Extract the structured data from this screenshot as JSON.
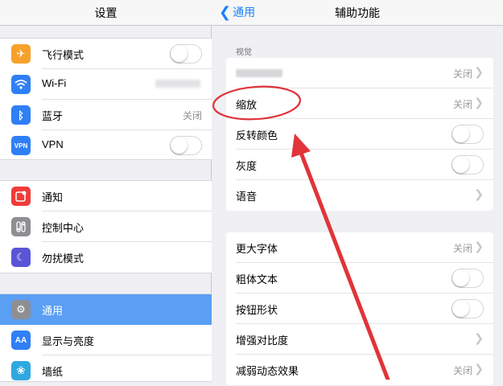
{
  "left": {
    "title": "设置",
    "group1": [
      {
        "label": "飞行模式",
        "icon": "airplane-icon",
        "icon_color": "#f7a12b",
        "control": "switch",
        "value": ""
      },
      {
        "label": "Wi-Fi",
        "icon": "wifi-icon",
        "icon_color": "#2f7ff6",
        "control": "value",
        "value": ""
      },
      {
        "label": "蓝牙",
        "icon": "bluetooth-icon",
        "icon_color": "#2f7ff6",
        "control": "value",
        "value": "关闭"
      },
      {
        "label": "VPN",
        "icon": "vpn-icon",
        "icon_color": "#2f7ff6",
        "control": "switch",
        "value": ""
      }
    ],
    "group2": [
      {
        "label": "通知",
        "icon": "notification-icon",
        "icon_color": "#f03b39"
      },
      {
        "label": "控制中心",
        "icon": "control-center-icon",
        "icon_color": "#8e8e93"
      },
      {
        "label": "勿扰模式",
        "icon": "moon-icon",
        "icon_color": "#5a55d6"
      }
    ],
    "group3": [
      {
        "label": "通用",
        "icon": "gear-icon",
        "icon_color": "#8e8e93",
        "selected": true
      },
      {
        "label": "显示与亮度",
        "icon": "display-icon",
        "icon_color": "#2f7ff6"
      },
      {
        "label": "墙纸",
        "icon": "wallpaper-icon",
        "icon_color": "#2fa8e0"
      }
    ]
  },
  "right": {
    "back_label": "通用",
    "title": "辅助功能",
    "section_label": "视觉",
    "card1": [
      {
        "label": "",
        "blurred": true,
        "value": "关闭",
        "chevron": true
      },
      {
        "label": "缩放",
        "value": "关闭",
        "chevron": true,
        "highlighted": true
      },
      {
        "label": "反转颜色",
        "control": "switch"
      },
      {
        "label": "灰度",
        "control": "switch"
      },
      {
        "label": "语音",
        "chevron": true
      }
    ],
    "card2": [
      {
        "label": "更大字体",
        "value": "关闭",
        "chevron": true
      },
      {
        "label": "粗体文本",
        "control": "switch"
      },
      {
        "label": "按钮形状",
        "control": "switch"
      },
      {
        "label": "增强对比度",
        "chevron": true
      },
      {
        "label": "减弱动态效果",
        "value": "关闭",
        "chevron": true
      }
    ]
  },
  "annotation_color": "#e0343a",
  "accent_color": "#1a82fb",
  "selection_color": "#5a9ff4"
}
